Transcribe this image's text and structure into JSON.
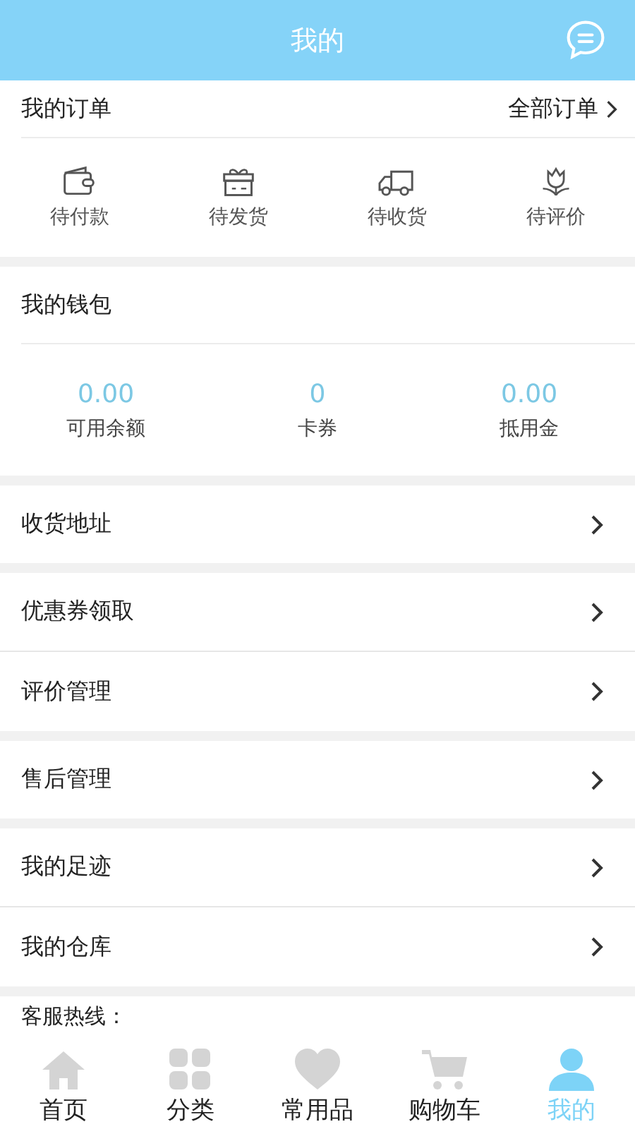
{
  "header": {
    "title": "我的"
  },
  "orders": {
    "title": "我的订单",
    "all_link": "全部订单",
    "items": [
      {
        "kind": "wallet",
        "label": "待付款"
      },
      {
        "kind": "gift",
        "label": "待发货"
      },
      {
        "kind": "truck",
        "label": "待收货"
      },
      {
        "kind": "flower",
        "label": "待评价"
      }
    ]
  },
  "wallet": {
    "title": "我的钱包",
    "items": [
      {
        "value": "0.00",
        "label": "可用余额"
      },
      {
        "value": "0",
        "label": "卡券"
      },
      {
        "value": "0.00",
        "label": "抵用金"
      }
    ]
  },
  "menu_groups": [
    [
      "收货地址"
    ],
    [
      "优惠券领取",
      "评价管理"
    ],
    [
      "售后管理"
    ],
    [
      "我的足迹",
      "我的仓库"
    ]
  ],
  "hotline": "客服热线：",
  "tab_bar": [
    {
      "kind": "home",
      "label": "首页",
      "selected": false
    },
    {
      "kind": "grid",
      "label": "分类",
      "selected": false
    },
    {
      "kind": "heart",
      "label": "常用品",
      "selected": false
    },
    {
      "kind": "cart",
      "label": "购物车",
      "selected": false
    },
    {
      "kind": "user",
      "label": "我的",
      "selected": true
    }
  ]
}
